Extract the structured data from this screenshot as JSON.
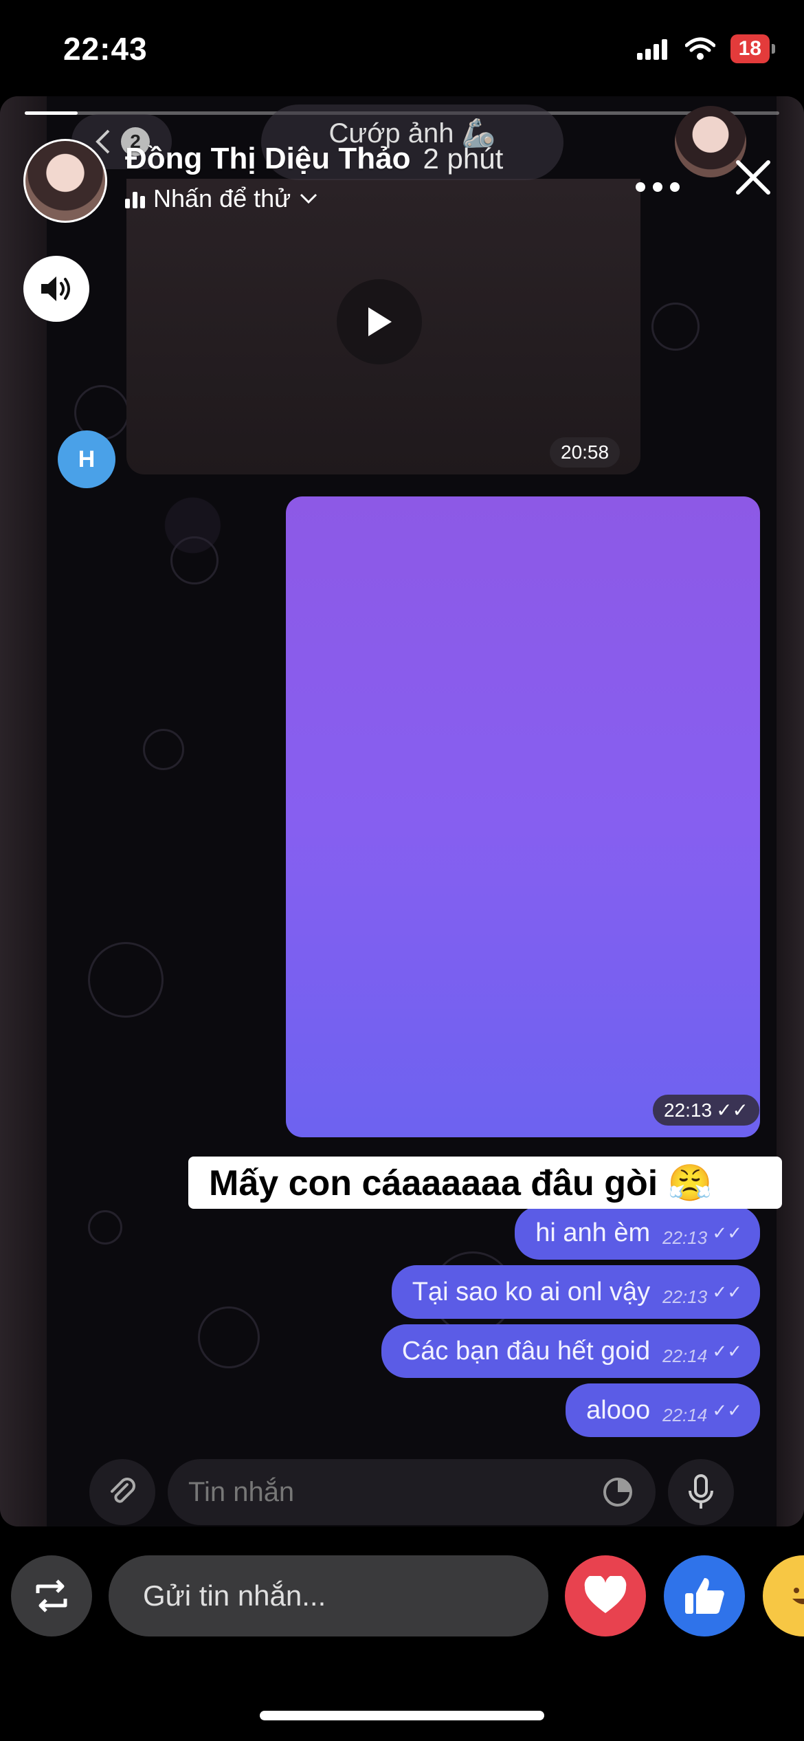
{
  "status_bar": {
    "time": "22:43",
    "battery": "18"
  },
  "story": {
    "progress": 0.07,
    "user_name": "Đồng Thị Diệu Thảo",
    "time_ago": "2 phút",
    "music_label": "Nhấn để thử",
    "grab_label": "Cướp ảnh 🦾",
    "back_count": "2",
    "icons": {
      "more": "more-dots-icon",
      "close": "close-icon",
      "sound": "speaker-icon",
      "play": "play-icon"
    }
  },
  "chat": {
    "sender_initial": "H",
    "video_time": "20:58",
    "image_time": "22:13",
    "sticker_caption": "Mấy con cáaaaaaa đâu gòi 😤",
    "messages": [
      {
        "text": "hi anh èm",
        "time": "22:13"
      },
      {
        "text": "Tại sao ko ai onl vậy",
        "time": "22:13"
      },
      {
        "text": "Các bạn đâu hết goid",
        "time": "22:14"
      },
      {
        "text": "alooo",
        "time": "22:14"
      }
    ],
    "input_placeholder": "Tin nhắn"
  },
  "bottom": {
    "reply_placeholder": "Gửi tin nhắn...",
    "colors": {
      "heart": "#e8424f",
      "like": "#2f73ea",
      "haha": "#f7c744"
    }
  }
}
